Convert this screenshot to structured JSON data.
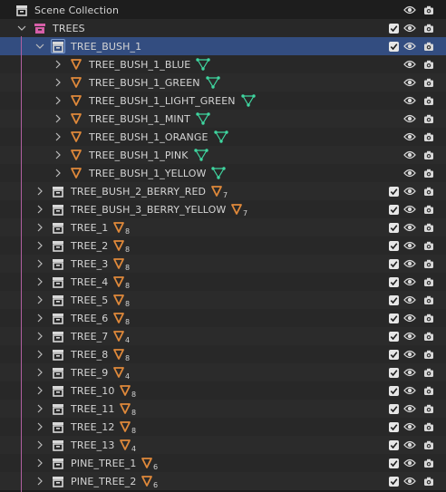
{
  "outliner": {
    "rows": [
      {
        "label": "Scene Collection",
        "kind": "scene",
        "indent": 0,
        "chevron": "none",
        "badge": null,
        "checkbox": false,
        "eye": true,
        "camera": true,
        "selected": false
      },
      {
        "label": "TREES",
        "kind": "collection_pink",
        "indent": 1,
        "chevron": "down",
        "badge": null,
        "checkbox": true,
        "eye": true,
        "camera": true,
        "selected": false
      },
      {
        "label": "TREE_BUSH_1",
        "kind": "collection",
        "indent": 2,
        "chevron": "down",
        "badge": null,
        "checkbox": true,
        "eye": true,
        "camera": true,
        "selected": true
      },
      {
        "label": "TREE_BUSH_1_BLUE",
        "kind": "mesh",
        "indent": 3,
        "chevron": "right",
        "badge": {
          "type": "vertex-groups",
          "count": ""
        },
        "checkbox": false,
        "eye": true,
        "camera": true,
        "selected": false
      },
      {
        "label": "TREE_BUSH_1_GREEN",
        "kind": "mesh",
        "indent": 3,
        "chevron": "right",
        "badge": {
          "type": "vertex-groups",
          "count": ""
        },
        "checkbox": false,
        "eye": true,
        "camera": true,
        "selected": false
      },
      {
        "label": "TREE_BUSH_1_LIGHT_GREEN",
        "kind": "mesh",
        "indent": 3,
        "chevron": "right",
        "badge": {
          "type": "vertex-groups",
          "count": ""
        },
        "checkbox": false,
        "eye": true,
        "camera": true,
        "selected": false
      },
      {
        "label": "TREE_BUSH_1_MINT",
        "kind": "mesh",
        "indent": 3,
        "chevron": "right",
        "badge": {
          "type": "vertex-groups",
          "count": ""
        },
        "checkbox": false,
        "eye": true,
        "camera": true,
        "selected": false
      },
      {
        "label": "TREE_BUSH_1_ORANGE",
        "kind": "mesh",
        "indent": 3,
        "chevron": "right",
        "badge": {
          "type": "vertex-groups",
          "count": ""
        },
        "checkbox": false,
        "eye": true,
        "camera": true,
        "selected": false
      },
      {
        "label": "TREE_BUSH_1_PINK",
        "kind": "mesh",
        "indent": 3,
        "chevron": "right",
        "badge": {
          "type": "vertex-groups",
          "count": ""
        },
        "checkbox": false,
        "eye": true,
        "camera": true,
        "selected": false
      },
      {
        "label": "TREE_BUSH_1_YELLOW",
        "kind": "mesh",
        "indent": 3,
        "chevron": "right",
        "badge": {
          "type": "vertex-groups",
          "count": ""
        },
        "checkbox": false,
        "eye": true,
        "camera": true,
        "selected": false
      },
      {
        "label": "TREE_BUSH_2_BERRY_RED",
        "kind": "collection",
        "indent": 2,
        "chevron": "right",
        "badge": {
          "type": "mesh",
          "count": "7"
        },
        "checkbox": true,
        "eye": true,
        "camera": true,
        "selected": false
      },
      {
        "label": "TREE_BUSH_3_BERRY_YELLOW",
        "kind": "collection",
        "indent": 2,
        "chevron": "right",
        "badge": {
          "type": "mesh",
          "count": "7"
        },
        "checkbox": true,
        "eye": true,
        "camera": true,
        "selected": false
      },
      {
        "label": "TREE_1",
        "kind": "collection",
        "indent": 2,
        "chevron": "right",
        "badge": {
          "type": "mesh",
          "count": "8"
        },
        "checkbox": true,
        "eye": true,
        "camera": true,
        "selected": false
      },
      {
        "label": "TREE_2",
        "kind": "collection",
        "indent": 2,
        "chevron": "right",
        "badge": {
          "type": "mesh",
          "count": "8"
        },
        "checkbox": true,
        "eye": true,
        "camera": true,
        "selected": false
      },
      {
        "label": "TREE_3",
        "kind": "collection",
        "indent": 2,
        "chevron": "right",
        "badge": {
          "type": "mesh",
          "count": "8"
        },
        "checkbox": true,
        "eye": true,
        "camera": true,
        "selected": false
      },
      {
        "label": "TREE_4",
        "kind": "collection",
        "indent": 2,
        "chevron": "right",
        "badge": {
          "type": "mesh",
          "count": "8"
        },
        "checkbox": true,
        "eye": true,
        "camera": true,
        "selected": false
      },
      {
        "label": "TREE_5",
        "kind": "collection",
        "indent": 2,
        "chevron": "right",
        "badge": {
          "type": "mesh",
          "count": "8"
        },
        "checkbox": true,
        "eye": true,
        "camera": true,
        "selected": false
      },
      {
        "label": "TREE_6",
        "kind": "collection",
        "indent": 2,
        "chevron": "right",
        "badge": {
          "type": "mesh",
          "count": "8"
        },
        "checkbox": true,
        "eye": true,
        "camera": true,
        "selected": false
      },
      {
        "label": "TREE_7",
        "kind": "collection",
        "indent": 2,
        "chevron": "right",
        "badge": {
          "type": "mesh",
          "count": "4"
        },
        "checkbox": true,
        "eye": true,
        "camera": true,
        "selected": false
      },
      {
        "label": "TREE_8",
        "kind": "collection",
        "indent": 2,
        "chevron": "right",
        "badge": {
          "type": "mesh",
          "count": "8"
        },
        "checkbox": true,
        "eye": true,
        "camera": true,
        "selected": false
      },
      {
        "label": "TREE_9",
        "kind": "collection",
        "indent": 2,
        "chevron": "right",
        "badge": {
          "type": "mesh",
          "count": "4"
        },
        "checkbox": true,
        "eye": true,
        "camera": true,
        "selected": false
      },
      {
        "label": "TREE_10",
        "kind": "collection",
        "indent": 2,
        "chevron": "right",
        "badge": {
          "type": "mesh",
          "count": "8"
        },
        "checkbox": true,
        "eye": true,
        "camera": true,
        "selected": false
      },
      {
        "label": "TREE_11",
        "kind": "collection",
        "indent": 2,
        "chevron": "right",
        "badge": {
          "type": "mesh",
          "count": "8"
        },
        "checkbox": true,
        "eye": true,
        "camera": true,
        "selected": false
      },
      {
        "label": "TREE_12",
        "kind": "collection",
        "indent": 2,
        "chevron": "right",
        "badge": {
          "type": "mesh",
          "count": "8"
        },
        "checkbox": true,
        "eye": true,
        "camera": true,
        "selected": false
      },
      {
        "label": "TREE_13",
        "kind": "collection",
        "indent": 2,
        "chevron": "right",
        "badge": {
          "type": "mesh",
          "count": "4"
        },
        "checkbox": true,
        "eye": true,
        "camera": true,
        "selected": false
      },
      {
        "label": "PINE_TREE_1",
        "kind": "collection",
        "indent": 2,
        "chevron": "right",
        "badge": {
          "type": "mesh",
          "count": "6"
        },
        "checkbox": true,
        "eye": true,
        "camera": true,
        "selected": false
      },
      {
        "label": "PINE_TREE_2",
        "kind": "collection",
        "indent": 2,
        "chevron": "right",
        "badge": {
          "type": "mesh",
          "count": "6"
        },
        "checkbox": true,
        "eye": true,
        "camera": true,
        "selected": false
      }
    ]
  },
  "colors": {
    "selected_row": "#334d80",
    "hierarchy_line": "#b05fa0",
    "mesh_orange": "#e0893a",
    "vertex_group_teal": "#3fd6a0",
    "collection_pink": "#d65fa8",
    "text": "#d4d4d4"
  }
}
